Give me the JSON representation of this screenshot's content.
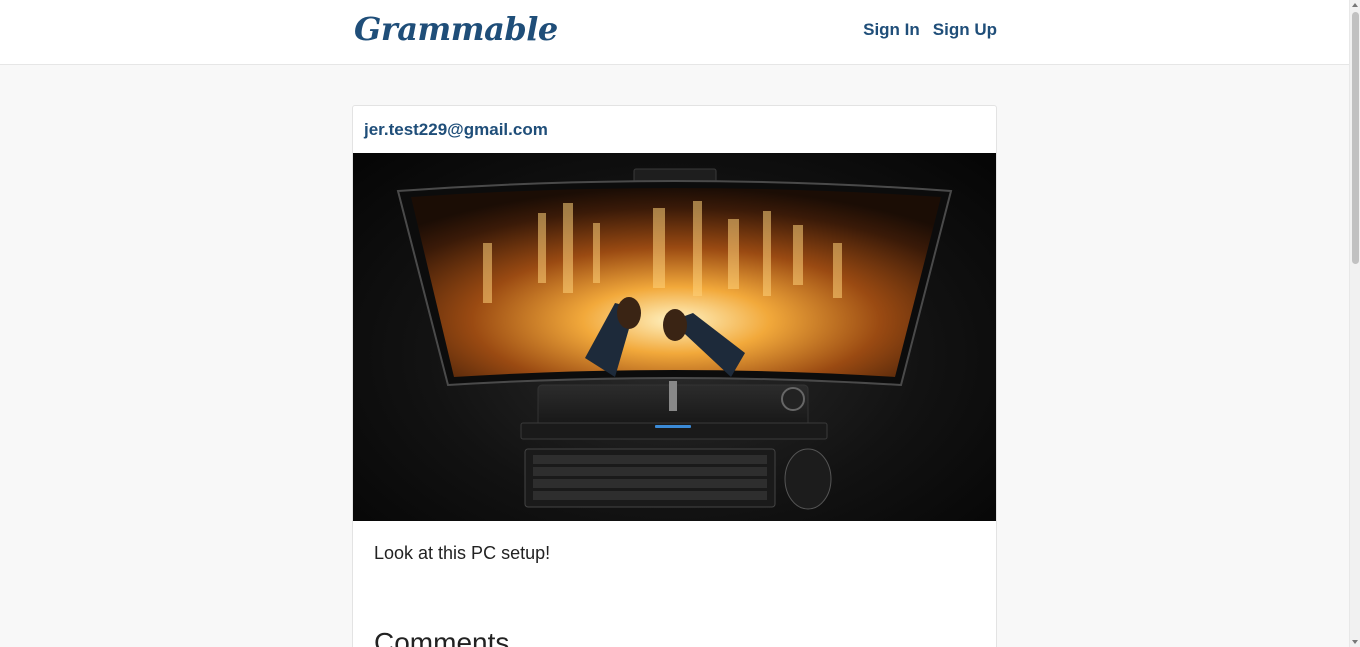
{
  "navbar": {
    "brand": "Grammable",
    "links": [
      {
        "label": "Sign In"
      },
      {
        "label": "Sign Up"
      }
    ]
  },
  "post": {
    "author_email": "jer.test229@gmail.com",
    "caption": "Look at this PC setup!",
    "comments_heading": "Comments"
  },
  "colors": {
    "brand": "#1f4e79",
    "background": "#f8f8f8",
    "card": "#ffffff"
  }
}
